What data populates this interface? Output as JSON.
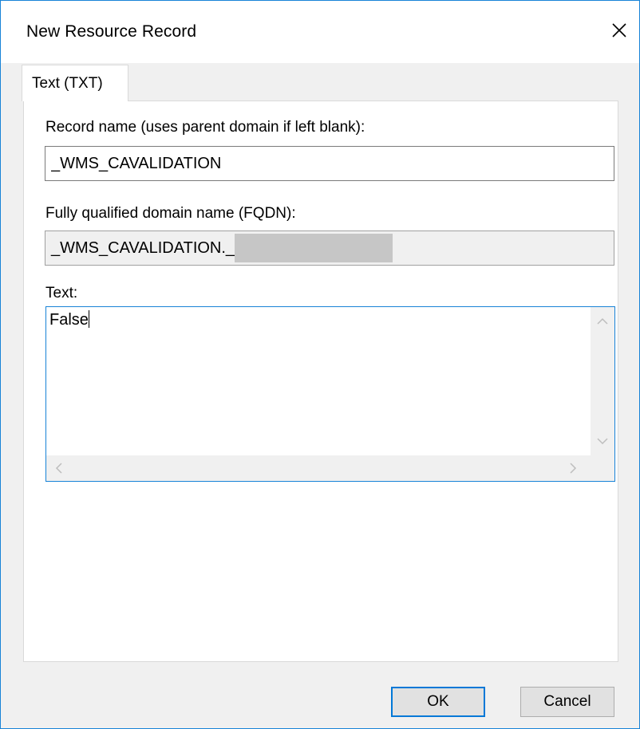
{
  "window": {
    "title": "New Resource Record"
  },
  "tabs": [
    {
      "label": "Text (TXT)",
      "selected": true
    }
  ],
  "form": {
    "record_name_label": "Record name (uses parent domain if left blank):",
    "record_name_value": "_WMS_CAVALIDATION",
    "fqdn_label": "Fully qualified domain name (FQDN):",
    "fqdn_value": "_WMS_CAVALIDATION._",
    "text_label": "Text:",
    "text_value": "False"
  },
  "buttons": {
    "ok_label": "OK",
    "cancel_label": "Cancel"
  },
  "icons": {
    "close": "close-icon",
    "scroll_up": "chevron-up-icon",
    "scroll_down": "chevron-down-icon",
    "scroll_left": "chevron-left-icon",
    "scroll_right": "chevron-right-icon"
  },
  "colors": {
    "accent": "#0078d7",
    "window_border": "#1883d7",
    "dialog_bg": "#f0f0f0",
    "redaction": "#c6c6c6"
  }
}
